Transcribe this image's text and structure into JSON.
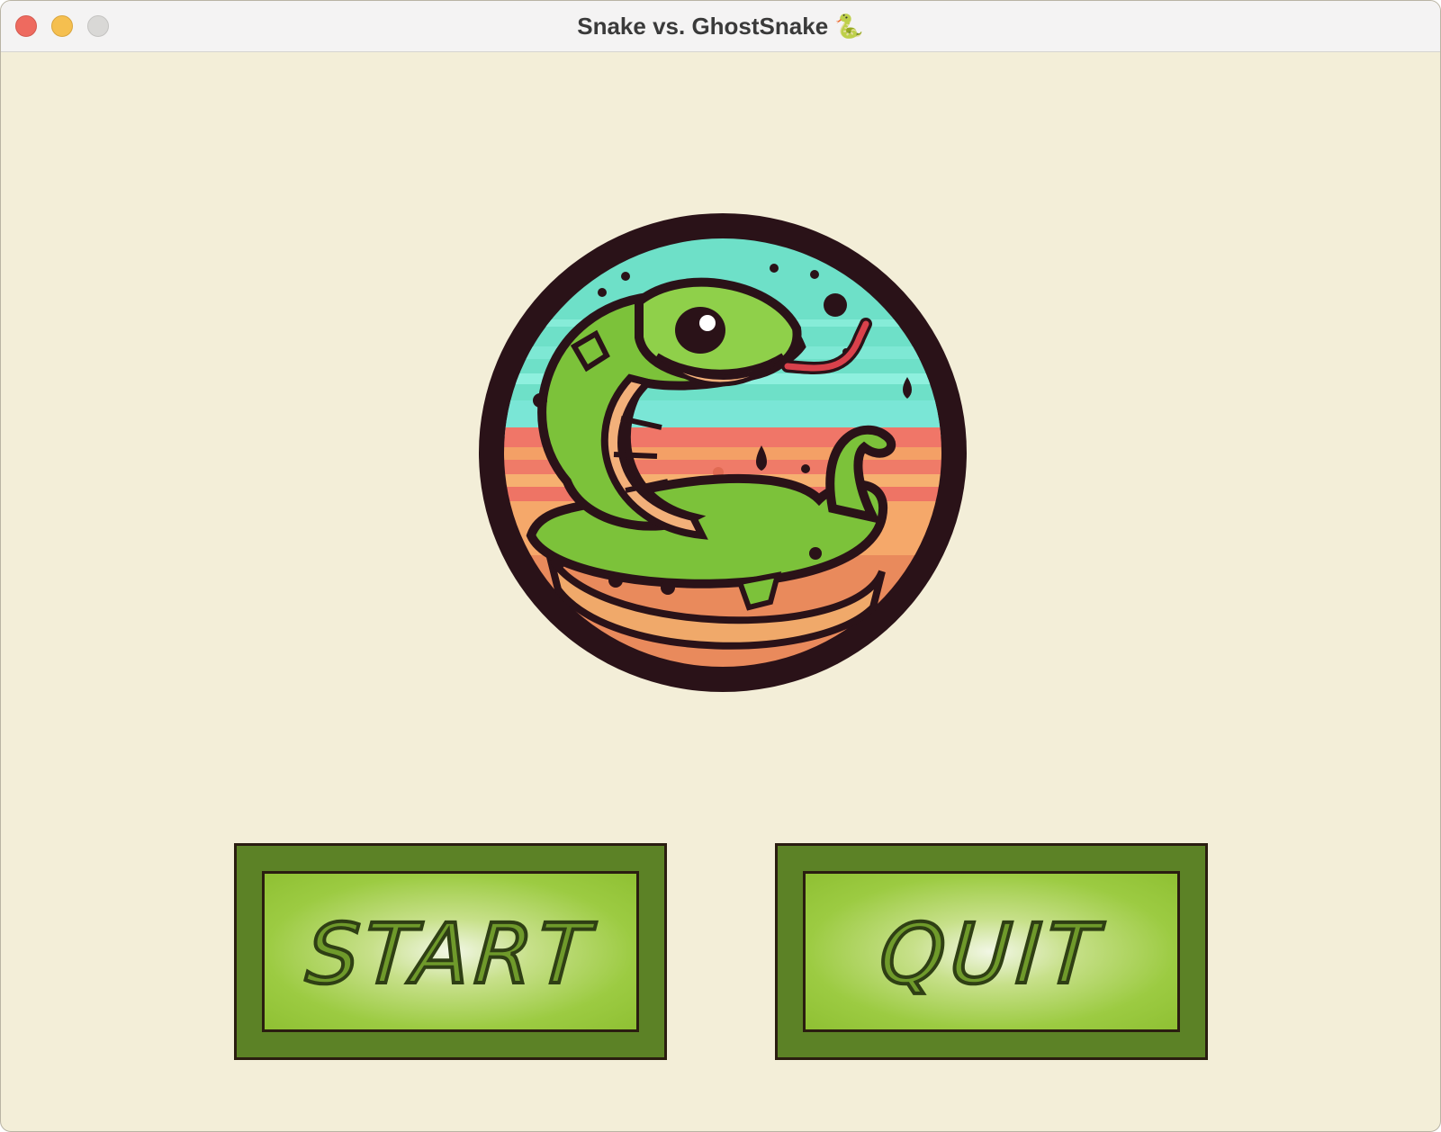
{
  "window": {
    "title": "Snake vs. GhostSnake 🐍"
  },
  "menu": {
    "logo_icon": "snake-logo",
    "start_label": "START",
    "quit_label": "QUIT"
  },
  "colors": {
    "background": "#f3eed8",
    "button_outer": "#5c8226",
    "button_inner": "#9ccb42",
    "outline": "#2a1d10"
  }
}
